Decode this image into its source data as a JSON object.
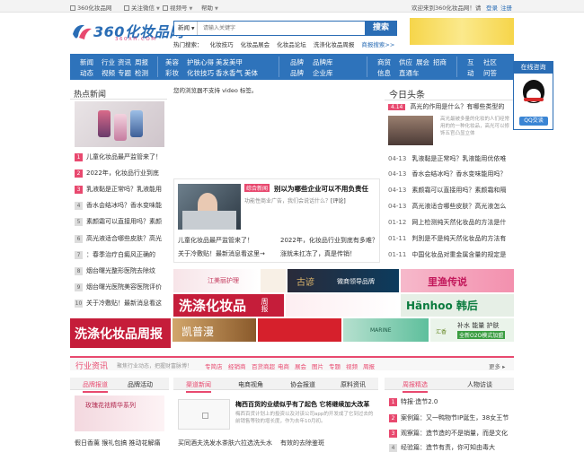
{
  "topbar": {
    "site": "360化妆品网",
    "follow": "关注微信",
    "mobile": "视频号",
    "help": "帮助",
    "welcome": "欢迎来到360化妆品网！请",
    "login": "登录",
    "register": "注册"
  },
  "logo": {
    "text": "360化妆品网",
    "sub": "360XH.COM"
  },
  "search": {
    "select": "新闻",
    "placeholder": "请输入关键字",
    "button": "搜索"
  },
  "hotsearch": {
    "label": "热门搜索：",
    "items": [
      "化妆技巧",
      "化妆品展会",
      "化妆品论坛",
      "洗涤化妆品周报"
    ],
    "more": "商报搜索>>"
  },
  "nav": {
    "cols": [
      {
        "head": [
          "新闻",
          "动态"
        ],
        "items": [
          "行业",
          "资讯",
          "周报",
          "视频",
          "专题",
          "检测"
        ]
      },
      {
        "head": [
          "美容",
          "彩妆"
        ],
        "items": [
          "护肤心得",
          "美发美甲",
          "化妆技巧",
          "香水香气",
          "美体",
          ""
        ]
      },
      {
        "head": [
          "品牌",
          "品牌"
        ],
        "items": [
          "品牌库",
          "企业库"
        ]
      },
      {
        "head": [
          "商贸",
          "信息"
        ],
        "items": [
          "供应",
          "展会",
          "招商",
          "直通车"
        ]
      },
      {
        "head": [
          "互",
          "动"
        ],
        "items": [
          "社区",
          "问答"
        ]
      }
    ]
  },
  "qq": {
    "header": "在线咨询",
    "button": "QQ交谈"
  },
  "hotnews": {
    "title": "热点新闻",
    "items": [
      "儿童化妆品最严监管来了！",
      "2022年，化妆品行业到底",
      "乳液黏是正常吗？乳液能用",
      "香水会结冰吗？香水变味能",
      "素颜霜可以直接用吗？素颜",
      "高光液适合哪些皮肤？高光",
      "：春季治疗白癜风正确的",
      "烟台曙光整形医院去除纹",
      "烟台曙光医院美容医院评价",
      "关于冷敷贴！最新消息看这"
    ]
  },
  "video": {
    "notice": "您的浏览器不支持 video 标签。"
  },
  "mid": {
    "tag": "综合新闻",
    "headline": "别以为哪些企业可以不用负责任",
    "summary": "功能性商业广告，我们会说话什么？",
    "review": "[评论]",
    "grid": [
      "儿童化妆品最严监管来了！",
      "2022年，化妆品行业到底有多难？",
      "关于冷敷贴！最新消息看这里→",
      "涨就未扛冻了，真是传销！"
    ]
  },
  "headline": {
    "title": "今日头条",
    "date": "4.14",
    "lead": "高光的作用是什么？有哪些类型的",
    "desc": "高光最被多量的化妆的人们经常用的的一种化妆品，高光可以修饰五官凸显立体",
    "rows": [
      {
        "d": "04-13",
        "t": "乳液黏是正常吗？乳液能用优依唯"
      },
      {
        "d": "04-13",
        "t": "香水会结冰吗？香水变味能用吗？"
      },
      {
        "d": "04-13",
        "t": "素颜霜可以直接用吗？素颜霜和隔"
      },
      {
        "d": "04-13",
        "t": "高光液适合哪些皮肤？高光液怎么"
      },
      {
        "d": "01-12",
        "t": "网上检测纯天然化妆品的方法是什"
      },
      {
        "d": "01-11",
        "t": "判別是不是纯天然化妆品的方法有"
      },
      {
        "d": "01-11",
        "t": "中国化妆品对重金属含量的规定是"
      }
    ]
  },
  "ads": {
    "a1": "江美丽护理",
    "a2": "古谚",
    "a3": "微商领导品牌",
    "a4": "里渔传说",
    "a5": "洗涤化妆品",
    "a6": "周报",
    "a7": "Hänhoo 韩后",
    "a8": "洗涤化妆品周报",
    "a9": "凯普漫",
    "a10": "MARINE",
    "a11": "全新O2O模式加盟",
    "a12": "汇香",
    "a13": "补水 能量 护肤"
  },
  "industry": {
    "title": "行业资讯",
    "desc": "聚焦行业动态，把握财富脉博！",
    "tags": [
      "专简店",
      "经销商",
      "百货商超",
      "电商",
      "展会",
      "图片",
      "专题",
      "视频",
      "周报"
    ],
    "more": "更多"
  },
  "bottom": {
    "tabsA": [
      "品牌报道",
      "品牌活动"
    ],
    "brandtitle": "玫瑰花祛精华系列",
    "brandnews": "假日香薰 猴礼包搞 推动花解痛",
    "tabsB": [
      "渠道新闻",
      "电商视角",
      "协会报道",
      "原料资讯"
    ],
    "lead": "梅西百货的业绩似乎有了起色 它将继续加大改革",
    "leaddesc": "梅西百货计划上的投资以及对该公司app的开发成了它到过去的前销售等较的增长度，作为去年10月初。",
    "news": [
      "买同酒夫洗发水茶肤六拉选洗头水",
      "有效的去除鉴斑"
    ],
    "tabsC": [
      "周报精选",
      "人物访谈"
    ],
    "weekly": [
      {
        "n": "1",
        "t": "特报·造节2.0"
      },
      {
        "n": "2",
        "t": "案例篇：又一鸭物节IP诞生，38女王节"
      },
      {
        "n": "3",
        "t": "观察篇：造节造的不是销量，而是文化"
      },
      {
        "n": "4",
        "t": "经验篇：造节有责，你可知由毒大"
      }
    ]
  }
}
